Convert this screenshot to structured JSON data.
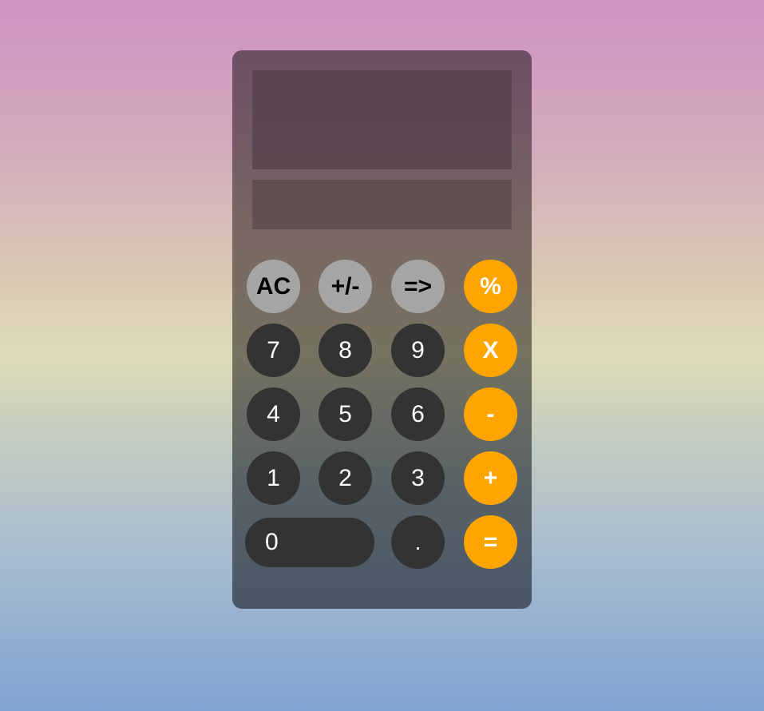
{
  "display": {
    "history": "",
    "current": ""
  },
  "keys": {
    "ac": "AC",
    "toggle_sign": "+/-",
    "backspace": "=>",
    "percent": "%",
    "seven": "7",
    "eight": "8",
    "nine": "9",
    "multiply": "X",
    "four": "4",
    "five": "5",
    "six": "6",
    "subtract": "-",
    "one": "1",
    "two": "2",
    "three": "3",
    "add": "+",
    "zero": "0",
    "decimal": ".",
    "equals": "="
  },
  "colors": {
    "function_key": "#a5a5a5",
    "number_key": "#333333",
    "operator_key": "#ffa500"
  }
}
